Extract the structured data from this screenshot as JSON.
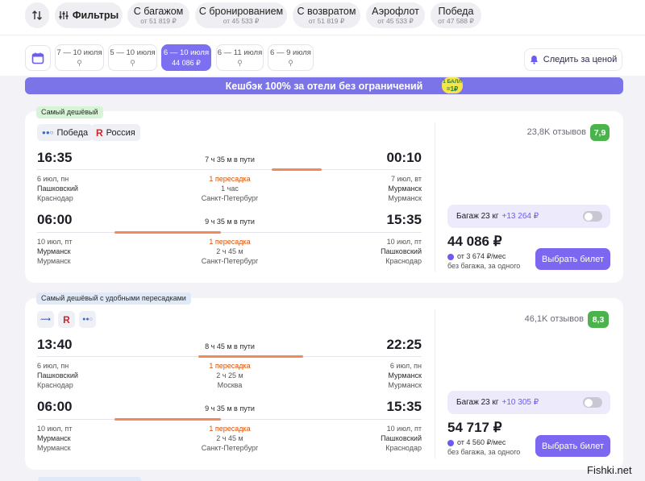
{
  "filter_bar": {
    "filters_label": "Фильтры",
    "chips": [
      {
        "title": "С багажом",
        "price": "от 51 819 ₽"
      },
      {
        "title": "С бронированием",
        "price": "от 45 533 ₽"
      },
      {
        "title": "С возвратом",
        "price": "от 51 819 ₽"
      },
      {
        "title": "Аэрофлот",
        "price": "от 45 533 ₽"
      },
      {
        "title": "Победа",
        "price": "от 47 588 ₽"
      }
    ]
  },
  "date_bar": {
    "dates": [
      {
        "label": "7 — 10 июля",
        "sub": "Q"
      },
      {
        "label": "5 — 10 июля",
        "sub": "Q"
      },
      {
        "label": "6 — 10 июля",
        "sub": "44 086 ₽"
      },
      {
        "label": "6 — 11 июля",
        "sub": "Q"
      },
      {
        "label": "6 — 9 июля",
        "sub": "Q"
      }
    ],
    "track_label": "Следить за ценой"
  },
  "banner": {
    "text": "Кешбэк 100% за отели без ограничений",
    "coin_line1": "1 БАЛЛ",
    "coin_line2": "=1₽"
  },
  "results": [
    {
      "tag": "Самый дешёвый",
      "airlines": [
        "Победа",
        "Россия"
      ],
      "reviews": "23,8K отзывов",
      "score": "7,9",
      "legs": [
        {
          "dep_time": "16:35",
          "arr_time": "00:10",
          "duration": "7 ч 35 м в пути",
          "dep_date": "6 июл, пн",
          "dep_airport": "Пашковский",
          "dep_city": "Краснодар",
          "stops": "1 пересадка",
          "stop_time": "1 час",
          "stop_city": "Санкт-Петербург",
          "arr_date": "7 июл, вт",
          "arr_airport": "Мурманск",
          "arr_city": "Мурманск"
        },
        {
          "dep_time": "06:00",
          "arr_time": "15:35",
          "duration": "9 ч 35 м в пути",
          "dep_date": "10 июл, пт",
          "dep_airport": "Мурманск",
          "dep_city": "Мурманск",
          "stops": "1 пересадка",
          "stop_time": "2 ч 45 м",
          "stop_city": "Санкт-Петербург",
          "arr_date": "10 июл, пт",
          "arr_airport": "Пашковский",
          "arr_city": "Краснодар"
        }
      ],
      "baggage": "Багаж 23 кг",
      "baggage_price": "+13 264 ₽",
      "price": "44 086 ₽",
      "installment": "от 3 674 ₽/мес",
      "no_bag": "без багажа, за одного",
      "buy": "Выбрать билет"
    },
    {
      "tag": "Самый дешёвый с удобными пересадками",
      "airlines": [],
      "reviews": "46,1K отзывов",
      "score": "8,3",
      "legs": [
        {
          "dep_time": "13:40",
          "arr_time": "22:25",
          "duration": "8 ч 45 м в пути",
          "dep_date": "6 июл, пн",
          "dep_airport": "Пашковский",
          "dep_city": "Краснодар",
          "stops": "1 пересадка",
          "stop_time": "2 ч 25 м",
          "stop_city": "Москва",
          "arr_date": "6 июл, пн",
          "arr_airport": "Мурманск",
          "arr_city": "Мурманск"
        },
        {
          "dep_time": "06:00",
          "arr_time": "15:35",
          "duration": "9 ч 35 м в пути",
          "dep_date": "10 июл, пт",
          "dep_airport": "Мурманск",
          "dep_city": "Мурманск",
          "stops": "1 пересадка",
          "stop_time": "2 ч 45 м",
          "stop_city": "Санкт-Петербург",
          "arr_date": "10 июл, пт",
          "arr_airport": "Пашковский",
          "arr_city": "Краснодар"
        }
      ],
      "baggage": "Багаж 23 кг",
      "baggage_price": "+10 305 ₽",
      "price": "54 717 ₽",
      "installment": "от 4 560 ₽/мес",
      "no_bag": "без багажа, за одного",
      "buy": "Выбрать билет"
    }
  ],
  "watermark": "Fishki.net",
  "colors": {
    "accent": "#7b67f0",
    "orange": "#f08a58",
    "green_score": "#4bb34b"
  }
}
